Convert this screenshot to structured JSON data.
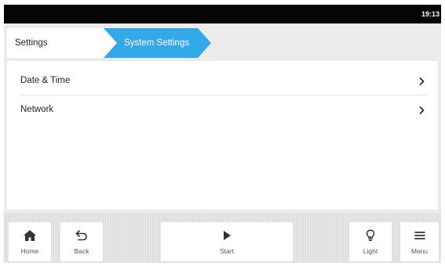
{
  "status_bar": {
    "time": "19:13"
  },
  "breadcrumb": {
    "items": [
      {
        "label": "Settings"
      },
      {
        "label": "System Settings"
      }
    ],
    "active_color": "#35a8e8"
  },
  "settings_list": {
    "items": [
      {
        "label": "Date & Time",
        "icon": "chevron-right-icon"
      },
      {
        "label": "Network",
        "icon": "chevron-right-icon"
      }
    ]
  },
  "bottom_nav": {
    "home": {
      "label": "Home",
      "icon": "home-icon"
    },
    "back": {
      "label": "Back",
      "icon": "back-arrow-icon"
    },
    "start": {
      "label": "Start",
      "icon": "play-icon"
    },
    "light": {
      "label": "Light",
      "icon": "lightbulb-icon"
    },
    "menu": {
      "label": "Menu",
      "icon": "hamburger-menu-icon"
    }
  }
}
